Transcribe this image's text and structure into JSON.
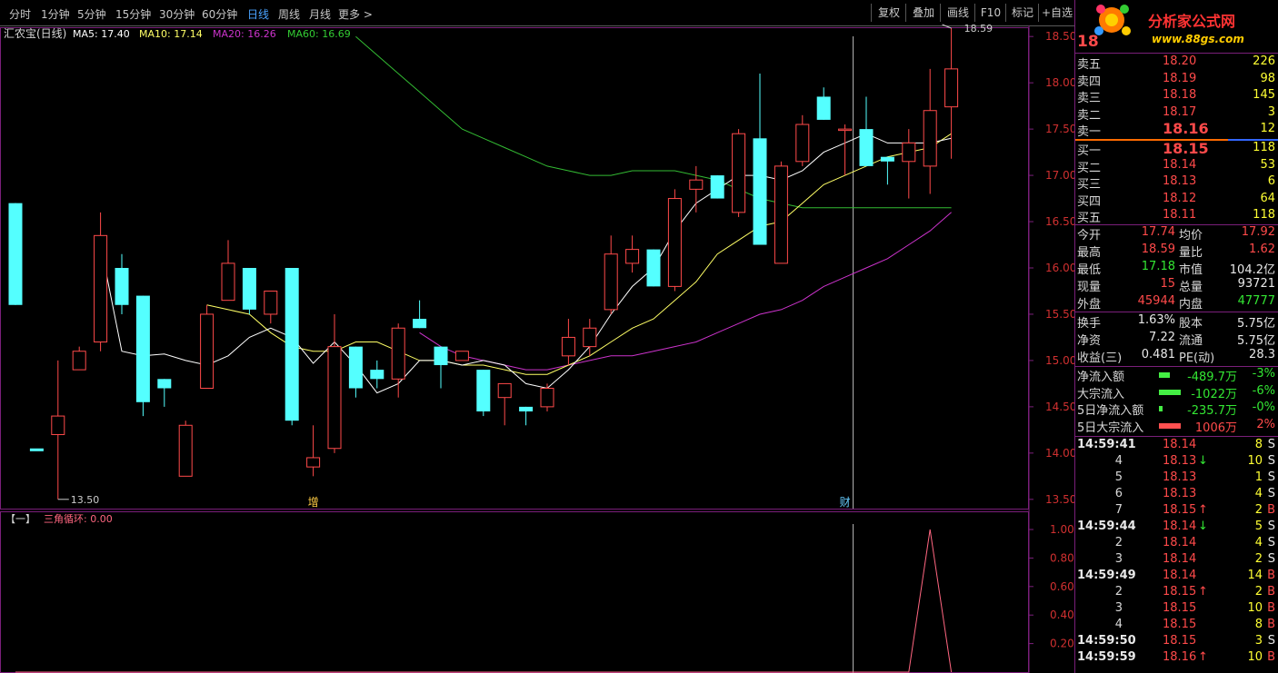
{
  "toolbar": {
    "tabs": [
      "分时",
      "1分钟",
      "5分钟",
      "15分钟",
      "30分钟",
      "60分钟",
      "日线",
      "周线",
      "月线",
      "更多 >"
    ],
    "active": 6,
    "buttons": [
      "复权",
      "叠加",
      "画线",
      "F10",
      "标记",
      "+自选"
    ]
  },
  "chart_data": [
    {
      "type": "candlestick",
      "title": "汇农宝(日线)",
      "legend": [
        {
          "name": "MA5",
          "value": "17.40",
          "color": "#ffffff"
        },
        {
          "name": "MA10",
          "value": "17.14",
          "color": "#ffff66"
        },
        {
          "name": "MA20",
          "value": "16.26",
          "color": "#cc33cc"
        },
        {
          "name": "MA60",
          "value": "16.69",
          "color": "#33cc33"
        }
      ],
      "y_ticks": [
        "18.50",
        "18.00",
        "17.50",
        "17.00",
        "16.50",
        "16.00",
        "15.50",
        "15.00",
        "14.50",
        "14.00",
        "13.50"
      ],
      "ylim": [
        13.4,
        18.6
      ],
      "max_label": "18.59",
      "min_label": "13.50",
      "markers": [
        {
          "text": "增",
          "index": 14
        },
        {
          "text": "财",
          "index": 39
        }
      ],
      "candles": [
        {
          "o": 15.6,
          "h": 16.7,
          "l": 15.6,
          "c": 16.7,
          "down": true
        },
        {
          "o": 14.05,
          "h": 14.0,
          "l": 14.0,
          "c": 14.02,
          "down": true
        },
        {
          "o": 14.2,
          "h": 15.0,
          "l": 13.5,
          "c": 14.4,
          "down": false
        },
        {
          "o": 14.9,
          "h": 15.15,
          "l": 14.9,
          "c": 15.1,
          "down": false
        },
        {
          "o": 15.2,
          "h": 16.6,
          "l": 15.1,
          "c": 16.35,
          "down": false
        },
        {
          "o": 16.0,
          "h": 16.15,
          "l": 15.5,
          "c": 15.6,
          "down": true
        },
        {
          "o": 15.7,
          "h": 15.7,
          "l": 14.4,
          "c": 14.55,
          "down": true
        },
        {
          "o": 14.7,
          "h": 14.8,
          "l": 14.5,
          "c": 14.8,
          "down": true
        },
        {
          "o": 13.75,
          "h": 14.35,
          "l": 13.75,
          "c": 14.3,
          "down": false
        },
        {
          "o": 14.7,
          "h": 15.6,
          "l": 14.7,
          "c": 15.5,
          "down": false
        },
        {
          "o": 15.65,
          "h": 16.3,
          "l": 15.65,
          "c": 16.05,
          "down": false
        },
        {
          "o": 16.0,
          "h": 16.0,
          "l": 15.5,
          "c": 15.55,
          "down": true
        },
        {
          "o": 15.5,
          "h": 15.75,
          "l": 15.4,
          "c": 15.75,
          "down": false
        },
        {
          "o": 16.0,
          "h": 16.0,
          "l": 14.3,
          "c": 14.35,
          "down": true
        },
        {
          "o": 13.85,
          "h": 14.3,
          "l": 13.75,
          "c": 13.95,
          "down": false
        },
        {
          "o": 14.05,
          "h": 15.5,
          "l": 14.0,
          "c": 15.15,
          "down": false
        },
        {
          "o": 15.15,
          "h": 15.15,
          "l": 14.6,
          "c": 14.7,
          "down": true
        },
        {
          "o": 14.8,
          "h": 15.0,
          "l": 14.7,
          "c": 14.9,
          "down": true
        },
        {
          "o": 14.8,
          "h": 15.4,
          "l": 14.6,
          "c": 15.35,
          "down": false
        },
        {
          "o": 15.45,
          "h": 15.65,
          "l": 15.35,
          "c": 15.35,
          "down": true
        },
        {
          "o": 15.15,
          "h": 15.15,
          "l": 14.7,
          "c": 14.95,
          "down": true
        },
        {
          "o": 15.0,
          "h": 15.1,
          "l": 15.0,
          "c": 15.1,
          "down": false
        },
        {
          "o": 14.9,
          "h": 14.9,
          "l": 14.4,
          "c": 14.45,
          "down": true
        },
        {
          "o": 14.6,
          "h": 14.75,
          "l": 14.3,
          "c": 14.75,
          "down": false
        },
        {
          "o": 14.5,
          "h": 14.5,
          "l": 14.3,
          "c": 14.45,
          "down": true
        },
        {
          "o": 14.5,
          "h": 14.75,
          "l": 14.45,
          "c": 14.7,
          "down": false
        },
        {
          "o": 15.05,
          "h": 15.45,
          "l": 14.95,
          "c": 15.25,
          "down": false
        },
        {
          "o": 15.15,
          "h": 15.45,
          "l": 15.05,
          "c": 15.35,
          "down": false
        },
        {
          "o": 15.55,
          "h": 16.35,
          "l": 15.5,
          "c": 16.15,
          "down": false
        },
        {
          "o": 16.05,
          "h": 16.35,
          "l": 15.95,
          "c": 16.2,
          "down": false
        },
        {
          "o": 16.2,
          "h": 16.2,
          "l": 15.8,
          "c": 15.8,
          "down": true
        },
        {
          "o": 15.8,
          "h": 16.85,
          "l": 15.75,
          "c": 16.75,
          "down": false
        },
        {
          "o": 16.85,
          "h": 17.1,
          "l": 16.6,
          "c": 16.95,
          "down": false
        },
        {
          "o": 17.0,
          "h": 17.0,
          "l": 16.75,
          "c": 16.75,
          "down": true
        },
        {
          "o": 16.6,
          "h": 17.5,
          "l": 16.55,
          "c": 17.45,
          "down": false
        },
        {
          "o": 17.4,
          "h": 18.1,
          "l": 16.25,
          "c": 16.25,
          "down": true
        },
        {
          "o": 16.05,
          "h": 17.15,
          "l": 16.05,
          "c": 17.1,
          "down": false
        },
        {
          "o": 17.15,
          "h": 17.65,
          "l": 17.1,
          "c": 17.55,
          "down": false
        },
        {
          "o": 17.85,
          "h": 17.95,
          "l": 17.6,
          "c": 17.6,
          "down": true
        },
        {
          "o": 17.5,
          "h": 17.55,
          "l": 17.0,
          "c": 17.5,
          "down": false
        },
        {
          "o": 17.5,
          "h": 17.85,
          "l": 17.1,
          "c": 17.1,
          "down": true
        },
        {
          "o": 17.2,
          "h": 17.2,
          "l": 16.9,
          "c": 17.15,
          "down": true
        },
        {
          "o": 17.15,
          "h": 17.5,
          "l": 16.75,
          "c": 17.35,
          "down": false
        },
        {
          "o": 17.1,
          "h": 18.15,
          "l": 16.8,
          "c": 17.7,
          "down": false
        },
        {
          "o": 17.74,
          "h": 18.59,
          "l": 17.18,
          "c": 18.15,
          "down": false
        }
      ],
      "ma5": [
        null,
        null,
        null,
        null,
        16.25,
        15.1,
        15.05,
        15.07,
        15.0,
        14.95,
        15.05,
        15.25,
        15.35,
        15.25,
        14.97,
        15.2,
        14.95,
        14.65,
        14.75,
        15.0,
        15.0,
        14.95,
        15.0,
        14.95,
        14.75,
        14.7,
        14.9,
        15.15,
        15.5,
        15.8,
        16.0,
        16.4,
        16.7,
        16.85,
        17.0,
        17.0,
        16.95,
        17.05,
        17.25,
        17.35,
        17.45,
        17.35,
        17.35,
        17.35,
        17.4
      ],
      "ma10": [
        null,
        null,
        null,
        null,
        null,
        null,
        null,
        null,
        null,
        15.6,
        15.55,
        15.5,
        15.3,
        15.15,
        15.1,
        15.1,
        15.2,
        15.2,
        15.1,
        15.0,
        15.0,
        14.95,
        14.95,
        14.9,
        14.85,
        14.85,
        14.95,
        15.05,
        15.2,
        15.35,
        15.45,
        15.65,
        15.85,
        16.15,
        16.3,
        16.45,
        16.5,
        16.7,
        16.9,
        17.0,
        17.1,
        17.2,
        17.25,
        17.3,
        17.45
      ],
      "ma20": [
        null,
        null,
        null,
        null,
        null,
        null,
        null,
        null,
        null,
        null,
        null,
        null,
        null,
        null,
        null,
        null,
        null,
        null,
        null,
        15.3,
        15.15,
        15.05,
        15.0,
        14.95,
        14.9,
        14.9,
        14.95,
        15.0,
        15.05,
        15.05,
        15.1,
        15.15,
        15.2,
        15.3,
        15.4,
        15.5,
        15.55,
        15.65,
        15.8,
        15.9,
        16.0,
        16.1,
        16.25,
        16.4,
        16.6
      ],
      "ma60": [
        null,
        null,
        null,
        null,
        null,
        null,
        null,
        null,
        null,
        null,
        null,
        null,
        null,
        null,
        null,
        null,
        18.5,
        18.3,
        18.1,
        17.9,
        17.7,
        17.5,
        17.4,
        17.3,
        17.2,
        17.1,
        17.05,
        17.0,
        17.0,
        17.05,
        17.05,
        17.05,
        17.0,
        16.95,
        16.85,
        16.75,
        16.7,
        16.65,
        16.65,
        16.65,
        16.65,
        16.65,
        16.65,
        16.65,
        16.65
      ]
    },
    {
      "type": "line",
      "title": "三角循环",
      "value_label": "0.00",
      "series_name": "三角循环",
      "y_ticks": [
        "1.00",
        "0.80",
        "0.60",
        "0.40",
        "0.20"
      ],
      "ylim": [
        0,
        1.0
      ],
      "values": [
        0,
        0,
        0,
        0,
        0,
        0,
        0,
        0,
        0,
        0,
        0,
        0,
        0,
        0,
        0,
        0,
        0,
        0,
        0,
        0,
        0,
        0,
        0,
        0,
        0,
        0,
        0,
        0,
        0,
        0,
        0,
        0,
        0,
        0,
        0,
        0,
        0,
        0,
        0,
        0,
        0,
        0,
        0,
        1.0,
        0
      ]
    }
  ],
  "side": {
    "logo": {
      "title": "分析家公式网",
      "url": "www.88gs.com"
    },
    "code": "18",
    "sell": [
      {
        "label": "卖五",
        "price": "18.20",
        "vol": "226"
      },
      {
        "label": "卖四",
        "price": "18.19",
        "vol": "98"
      },
      {
        "label": "卖三",
        "price": "18.18",
        "vol": "145"
      },
      {
        "label": "卖二",
        "price": "18.17",
        "vol": "3"
      },
      {
        "label": "卖一",
        "price": "18.16",
        "vol": "12"
      }
    ],
    "buy": [
      {
        "label": "买一",
        "price": "18.15",
        "vol": "118"
      },
      {
        "label": "买二",
        "price": "18.14",
        "vol": "53"
      },
      {
        "label": "买三",
        "price": "18.13",
        "vol": "6"
      },
      {
        "label": "买四",
        "price": "18.12",
        "vol": "64"
      },
      {
        "label": "买五",
        "price": "18.11",
        "vol": "118"
      }
    ],
    "stats": [
      {
        "l1": "今开",
        "v1": "17.74",
        "c1": "red",
        "l2": "均价",
        "v2": "17.92",
        "c2": "red"
      },
      {
        "l1": "最高",
        "v1": "18.59",
        "c1": "red",
        "l2": "量比",
        "v2": "1.62",
        "c2": "red"
      },
      {
        "l1": "最低",
        "v1": "17.18",
        "c1": "green",
        "l2": "市值",
        "v2": "104.2亿",
        "c2": "wht"
      },
      {
        "l1": "现量",
        "v1": "15",
        "c1": "red",
        "l2": "总量",
        "v2": "93721",
        "c2": "wht"
      },
      {
        "l1": "外盘",
        "v1": "45944",
        "c1": "red",
        "l2": "内盘",
        "v2": "47777",
        "c2": "green"
      }
    ],
    "stats2": [
      {
        "l1": "换手",
        "v1": "1.63%",
        "l2": "股本",
        "v2": "5.75亿"
      },
      {
        "l1": "净资",
        "v1": "7.22",
        "l2": "流通",
        "v2": "5.75亿"
      },
      {
        "l1": "收益(三)",
        "v1": "0.481",
        "l2": "PE(动)",
        "v2": "28.3"
      }
    ],
    "flows": [
      {
        "label": "净流入额",
        "value": "-489.7万",
        "pct": "-3%",
        "color": "green",
        "bar": 0.25
      },
      {
        "label": "大宗流入",
        "value": "-1022万",
        "pct": "-6%",
        "color": "green",
        "bar": 0.5
      },
      {
        "label": "5日净流入额",
        "value": "-235.7万",
        "pct": "-0%",
        "color": "green",
        "bar": 0.08
      },
      {
        "label": "5日大宗流入",
        "value": "1006万",
        "pct": "2%",
        "color": "red",
        "bar": 0.5
      }
    ],
    "ticks": [
      {
        "time": "14:59:41",
        "price": "18.14",
        "pc": "red",
        "arrow": "",
        "vol": "8",
        "bs": "S"
      },
      {
        "time": "4",
        "price": "18.13",
        "pc": "red",
        "arrow": "↓",
        "vol": "10",
        "bs": "S"
      },
      {
        "time": "5",
        "price": "18.13",
        "pc": "red",
        "arrow": "",
        "vol": "1",
        "bs": "S"
      },
      {
        "time": "6",
        "price": "18.13",
        "pc": "red",
        "arrow": "",
        "vol": "4",
        "bs": "S"
      },
      {
        "time": "7",
        "price": "18.15",
        "pc": "red",
        "arrow": "↑",
        "vol": "2",
        "bs": "B"
      },
      {
        "time": "14:59:44",
        "price": "18.14",
        "pc": "red",
        "arrow": "↓",
        "vol": "5",
        "bs": "S"
      },
      {
        "time": "2",
        "price": "18.14",
        "pc": "red",
        "arrow": "",
        "vol": "4",
        "bs": "S"
      },
      {
        "time": "3",
        "price": "18.14",
        "pc": "red",
        "arrow": "",
        "vol": "2",
        "bs": "S"
      },
      {
        "time": "14:59:49",
        "price": "18.14",
        "pc": "red",
        "arrow": "",
        "vol": "14",
        "bs": "B"
      },
      {
        "time": "2",
        "price": "18.15",
        "pc": "red",
        "arrow": "↑",
        "vol": "2",
        "bs": "B"
      },
      {
        "time": "3",
        "price": "18.15",
        "pc": "red",
        "arrow": "",
        "vol": "10",
        "bs": "B"
      },
      {
        "time": "4",
        "price": "18.15",
        "pc": "red",
        "arrow": "",
        "vol": "8",
        "bs": "B"
      },
      {
        "time": "14:59:50",
        "price": "18.15",
        "pc": "red",
        "arrow": "",
        "vol": "3",
        "bs": "S"
      },
      {
        "time": "14:59:59",
        "price": "18.16",
        "pc": "red",
        "arrow": "↑",
        "vol": "10",
        "bs": "B"
      }
    ]
  }
}
